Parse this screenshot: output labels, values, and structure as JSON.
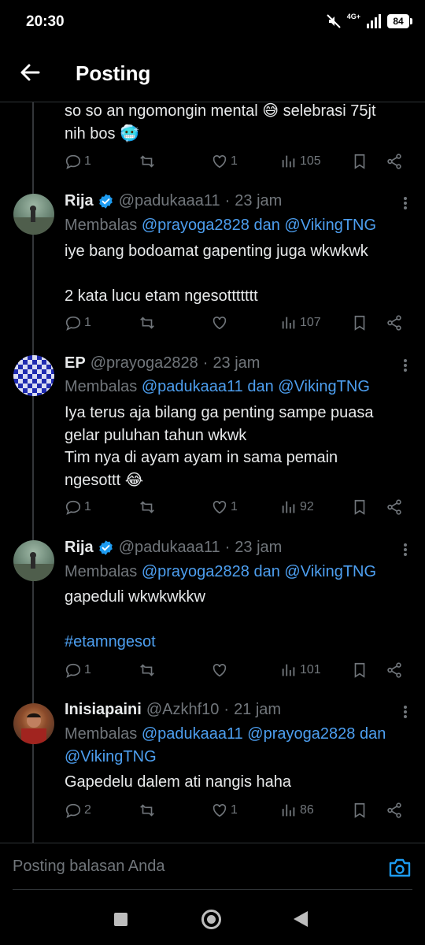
{
  "status_bar": {
    "time": "20:30",
    "network": "4G+",
    "battery": "84"
  },
  "header": {
    "title": "Posting"
  },
  "tweets": [
    {
      "lines": [
        "so so an ngomongin mental 😅 selebrasi 75jt",
        "nih bos 🥶"
      ],
      "replies": "1",
      "retweets": "",
      "likes": "1",
      "views": "105"
    },
    {
      "name": "Rija",
      "handle": "@padukaaa11",
      "time": "23 jam",
      "verified": true,
      "reply_prefix": "Membalas",
      "reply_mentions": "@prayoga2828",
      "reply_and": "dan",
      "reply_mentions2": "@VikingTNG",
      "lines": [
        "iye bang bodoamat gapenting juga wkwkwk",
        "",
        "2 kata lucu etam ngesottttttt"
      ],
      "replies": "1",
      "retweets": "",
      "likes": "",
      "views": "107"
    },
    {
      "name": "EP",
      "handle": "@prayoga2828",
      "time": "23 jam",
      "verified": false,
      "reply_prefix": "Membalas",
      "reply_mentions": "@padukaaa11",
      "reply_and": "dan",
      "reply_mentions2": "@VikingTNG",
      "lines": [
        "Iya terus aja bilang ga penting sampe puasa",
        "gelar puluhan tahun wkwk",
        "Tim nya di ayam ayam in sama pemain",
        "ngesottt 😂"
      ],
      "replies": "1",
      "retweets": "",
      "likes": "1",
      "views": "92"
    },
    {
      "name": "Rija",
      "handle": "@padukaaa11",
      "time": "23 jam",
      "verified": true,
      "reply_prefix": "Membalas",
      "reply_mentions": "@prayoga2828",
      "reply_and": "dan",
      "reply_mentions2": "@VikingTNG",
      "lines": [
        "gapeduli wkwkwkkw",
        "",
        "#etamngesot"
      ],
      "replies": "1",
      "retweets": "",
      "likes": "",
      "views": "101"
    },
    {
      "name": "Inisiapaini",
      "handle": "@Azkhf10",
      "time": "21 jam",
      "verified": false,
      "reply_prefix": "Membalas",
      "reply_mentions": "@padukaaa11 @prayoga2828",
      "reply_and": "dan",
      "reply_mentions2": "@VikingTNG",
      "lines": [
        "Gapedelu dalem ati nangis haha"
      ],
      "replies": "2",
      "retweets": "",
      "likes": "1",
      "views": "86"
    }
  ],
  "composer": {
    "placeholder": "Posting balasan Anda"
  },
  "colors": {
    "accent": "#4d9ff0",
    "muted": "#71767b",
    "text": "#e7e9ea",
    "background": "#000000"
  }
}
